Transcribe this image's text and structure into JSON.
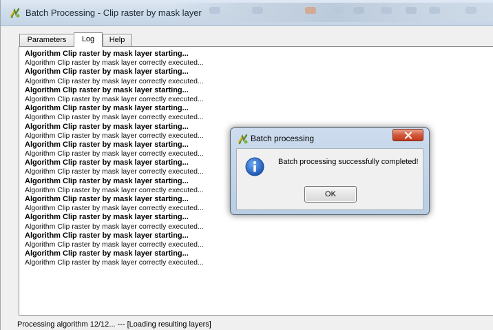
{
  "window": {
    "title": "Batch Processing - Clip raster by mask layer",
    "icon": "qgis-processing-icon"
  },
  "tabs": [
    {
      "label": "Parameters",
      "active": false
    },
    {
      "label": "Log",
      "active": true
    },
    {
      "label": "Help",
      "active": false
    }
  ],
  "log": {
    "lines": [
      {
        "text": "Algorithm Clip raster by mask layer starting...",
        "bold": true
      },
      {
        "text": "Algorithm Clip raster by mask layer correctly executed...",
        "bold": false
      },
      {
        "text": "Algorithm Clip raster by mask layer starting...",
        "bold": true
      },
      {
        "text": "Algorithm Clip raster by mask layer correctly executed...",
        "bold": false
      },
      {
        "text": "Algorithm Clip raster by mask layer starting...",
        "bold": true
      },
      {
        "text": "Algorithm Clip raster by mask layer correctly executed...",
        "bold": false
      },
      {
        "text": "Algorithm Clip raster by mask layer starting...",
        "bold": true
      },
      {
        "text": "Algorithm Clip raster by mask layer correctly executed...",
        "bold": false
      },
      {
        "text": "Algorithm Clip raster by mask layer starting...",
        "bold": true
      },
      {
        "text": "Algorithm Clip raster by mask layer correctly executed...",
        "bold": false
      },
      {
        "text": "Algorithm Clip raster by mask layer starting...",
        "bold": true
      },
      {
        "text": "Algorithm Clip raster by mask layer correctly executed...",
        "bold": false
      },
      {
        "text": "Algorithm Clip raster by mask layer starting...",
        "bold": true
      },
      {
        "text": "Algorithm Clip raster by mask layer correctly executed...",
        "bold": false
      },
      {
        "text": "Algorithm Clip raster by mask layer starting...",
        "bold": true
      },
      {
        "text": "Algorithm Clip raster by mask layer correctly executed...",
        "bold": false
      },
      {
        "text": "Algorithm Clip raster by mask layer starting...",
        "bold": true
      },
      {
        "text": "Algorithm Clip raster by mask layer correctly executed...",
        "bold": false
      },
      {
        "text": "Algorithm Clip raster by mask layer starting...",
        "bold": true
      },
      {
        "text": "Algorithm Clip raster by mask layer correctly executed...",
        "bold": false
      },
      {
        "text": "Algorithm Clip raster by mask layer starting...",
        "bold": true
      },
      {
        "text": "Algorithm Clip raster by mask layer correctly executed...",
        "bold": false
      },
      {
        "text": "Algorithm Clip raster by mask layer starting...",
        "bold": true
      },
      {
        "text": "Algorithm Clip raster by mask layer correctly executed...",
        "bold": false
      }
    ]
  },
  "status": {
    "text": "Processing algorithm 12/12...   --- [Loading resulting layers]"
  },
  "dialog": {
    "title": "Batch processing",
    "icon": "qgis-processing-icon",
    "message": "Batch processing successfully completed!",
    "message_icon": "info-icon",
    "ok_label": "OK",
    "close_icon": "close-icon"
  },
  "colors": {
    "titlebar": "#cfdcea",
    "dialog_frame": "#b9cde3",
    "close_button": "#c8462a",
    "info_blue": "#2a6fc9"
  }
}
